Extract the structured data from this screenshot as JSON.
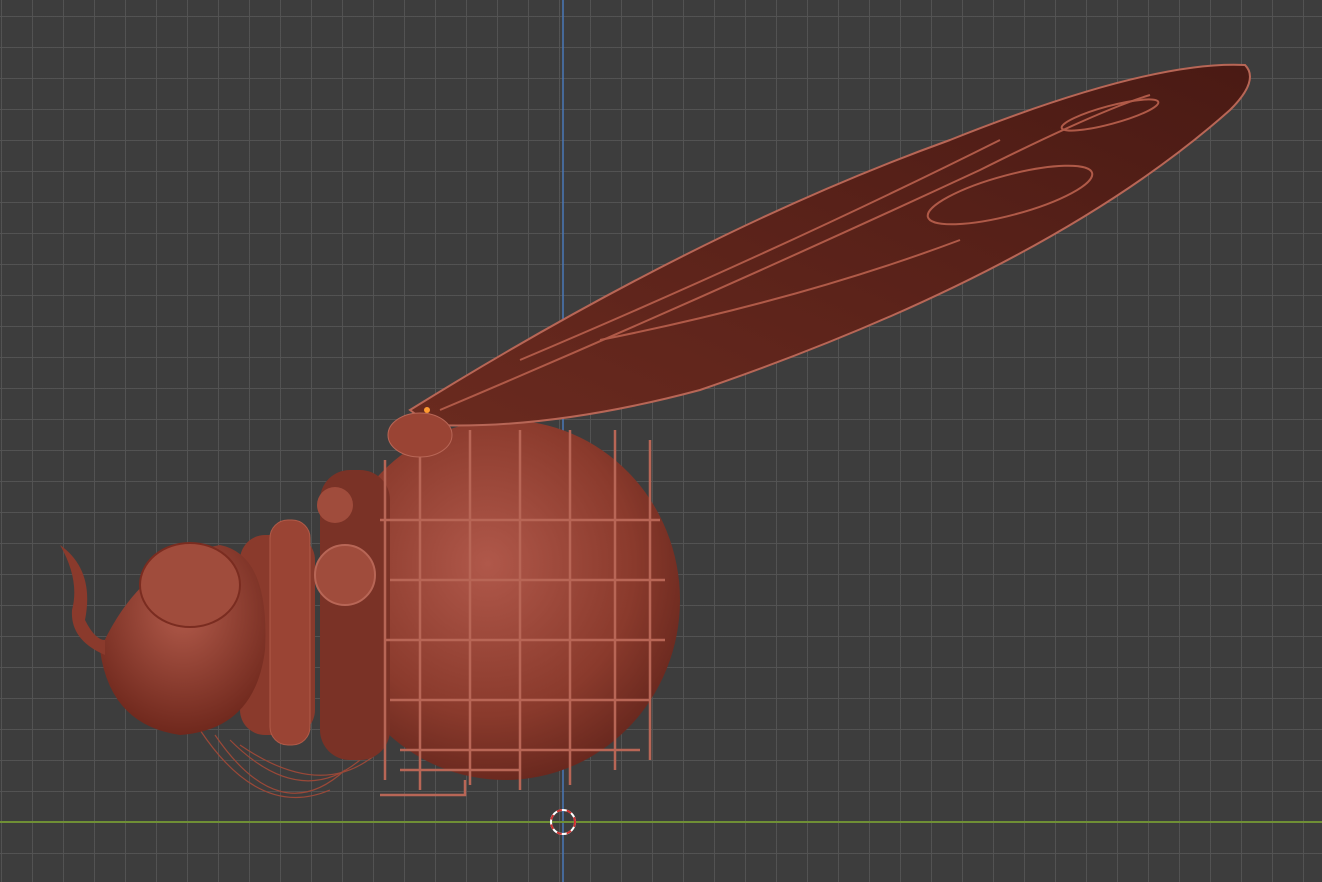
{
  "viewport": {
    "background_color": "#3d3d3d",
    "grid_color": "#555555",
    "x_axis_color": "#6f8f35",
    "z_axis_color": "#4a78b8",
    "model_color": "#8a3a2c",
    "cursor_icon": "3d-cursor-icon"
  }
}
